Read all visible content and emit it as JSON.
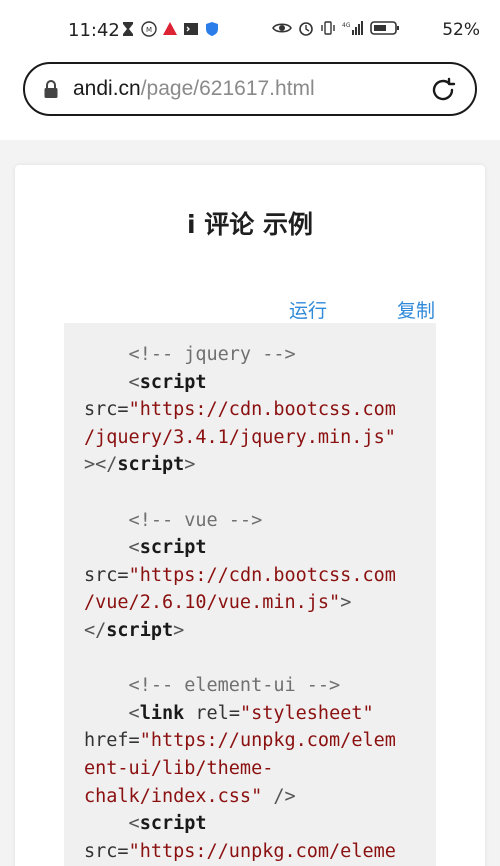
{
  "status_bar": {
    "time": "11:42",
    "battery": "52%",
    "network": "4G"
  },
  "browser": {
    "url_host": "andi.cn",
    "url_path": "/page/621617.html"
  },
  "article": {
    "title": "i 评论 示例",
    "run_label": "运行",
    "copy_label": "复制"
  },
  "code_lines": [
    [
      {
        "t": "comment",
        "v": "    <!-- jquery -->"
      }
    ],
    [
      {
        "t": "punc",
        "v": "    <"
      },
      {
        "t": "tag",
        "v": "script"
      }
    ],
    [
      {
        "t": "attr",
        "v": "src="
      },
      {
        "t": "str",
        "v": "\"https://cdn.bootcss.com"
      }
    ],
    [
      {
        "t": "str",
        "v": "/jquery/3.4.1/jquery.min.js\""
      }
    ],
    [
      {
        "t": "punc",
        "v": "></"
      },
      {
        "t": "tag",
        "v": "script"
      },
      {
        "t": "punc",
        "v": ">"
      }
    ],
    [
      {
        "t": "punc",
        "v": ""
      }
    ],
    [
      {
        "t": "comment",
        "v": "    <!-- vue -->"
      }
    ],
    [
      {
        "t": "punc",
        "v": "    <"
      },
      {
        "t": "tag",
        "v": "script"
      }
    ],
    [
      {
        "t": "attr",
        "v": "src="
      },
      {
        "t": "str",
        "v": "\"https://cdn.bootcss.com"
      }
    ],
    [
      {
        "t": "str",
        "v": "/vue/2.6.10/vue.min.js\""
      },
      {
        "t": "punc",
        "v": ">"
      }
    ],
    [
      {
        "t": "punc",
        "v": "</"
      },
      {
        "t": "tag",
        "v": "script"
      },
      {
        "t": "punc",
        "v": ">"
      }
    ],
    [
      {
        "t": "punc",
        "v": ""
      }
    ],
    [
      {
        "t": "comment",
        "v": "    <!-- element-ui -->"
      }
    ],
    [
      {
        "t": "punc",
        "v": "    <"
      },
      {
        "t": "tag",
        "v": "link"
      },
      {
        "t": "attr",
        "v": " rel="
      },
      {
        "t": "str",
        "v": "\"stylesheet\""
      }
    ],
    [
      {
        "t": "attr",
        "v": "href="
      },
      {
        "t": "str",
        "v": "\"https://unpkg.com/elem"
      }
    ],
    [
      {
        "t": "str",
        "v": "ent-ui/lib/theme-"
      }
    ],
    [
      {
        "t": "str",
        "v": "chalk/index.css\""
      },
      {
        "t": "punc",
        "v": " />"
      }
    ],
    [
      {
        "t": "punc",
        "v": "    <"
      },
      {
        "t": "tag",
        "v": "script"
      }
    ],
    [
      {
        "t": "attr",
        "v": "src="
      },
      {
        "t": "str",
        "v": "\"https://unpkg.com/eleme"
      }
    ]
  ]
}
